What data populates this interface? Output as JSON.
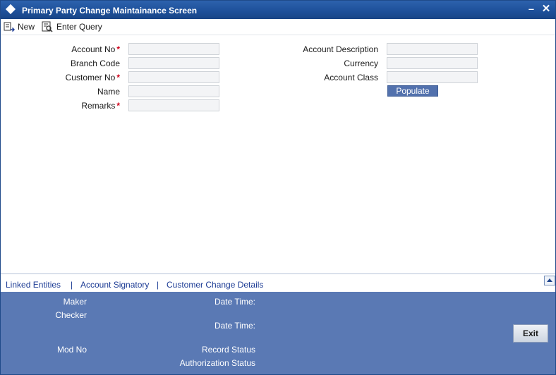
{
  "window": {
    "title": "Primary Party Change Maintainance Screen",
    "minimize_glyph": "‒",
    "close_glyph": "✕"
  },
  "toolbar": {
    "new_label": "New",
    "enter_query_label": "Enter Query"
  },
  "form": {
    "account_no": {
      "label": "Account No",
      "required": "*",
      "value": ""
    },
    "branch_code": {
      "label": "Branch Code",
      "value": ""
    },
    "customer_no": {
      "label": "Customer No",
      "required": "*",
      "value": ""
    },
    "name": {
      "label": "Name",
      "value": ""
    },
    "remarks": {
      "label": "Remarks",
      "required": "*",
      "value": ""
    },
    "account_description": {
      "label": "Account Description",
      "value": ""
    },
    "currency": {
      "label": "Currency",
      "value": ""
    },
    "account_class": {
      "label": "Account Class",
      "value": ""
    },
    "populate_label": "Populate"
  },
  "tabs": [
    {
      "label": "Linked Entities"
    },
    {
      "label": "Account Signatory"
    },
    {
      "label": "Customer Change Details"
    }
  ],
  "tab_separator": "|",
  "footer": {
    "maker_label": "Maker",
    "checker_label": "Checker",
    "date_time_label": "Date Time:",
    "mod_no_label": "Mod No",
    "record_status_label": "Record Status",
    "authorization_status_label": "Authorization Status",
    "exit_label": "Exit"
  },
  "colors": {
    "titlebar": "#1d4f99",
    "footer": "#5a79b4",
    "required": "#d0021b",
    "link": "#1d3c95"
  }
}
